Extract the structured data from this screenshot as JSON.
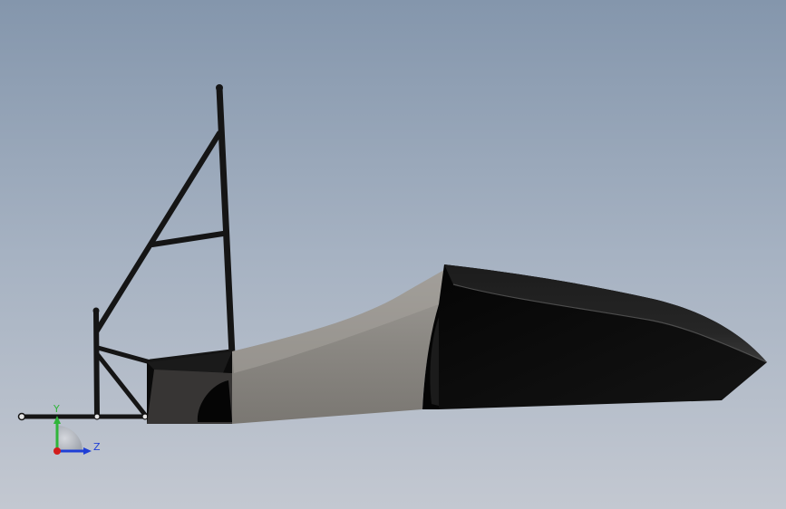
{
  "triad": {
    "y_label": "Y",
    "z_label": "Z",
    "colors": {
      "y_axis": "#2fb53a",
      "z_axis": "#1f3fd6",
      "x_axis": "#d21c1c"
    }
  },
  "scene": {
    "background_top": "#8496ac",
    "background_bottom": "#c3c8d1",
    "body_dark": "#0d0d0d",
    "body_gray": "#8b8884",
    "frame_tube": "#151515"
  }
}
